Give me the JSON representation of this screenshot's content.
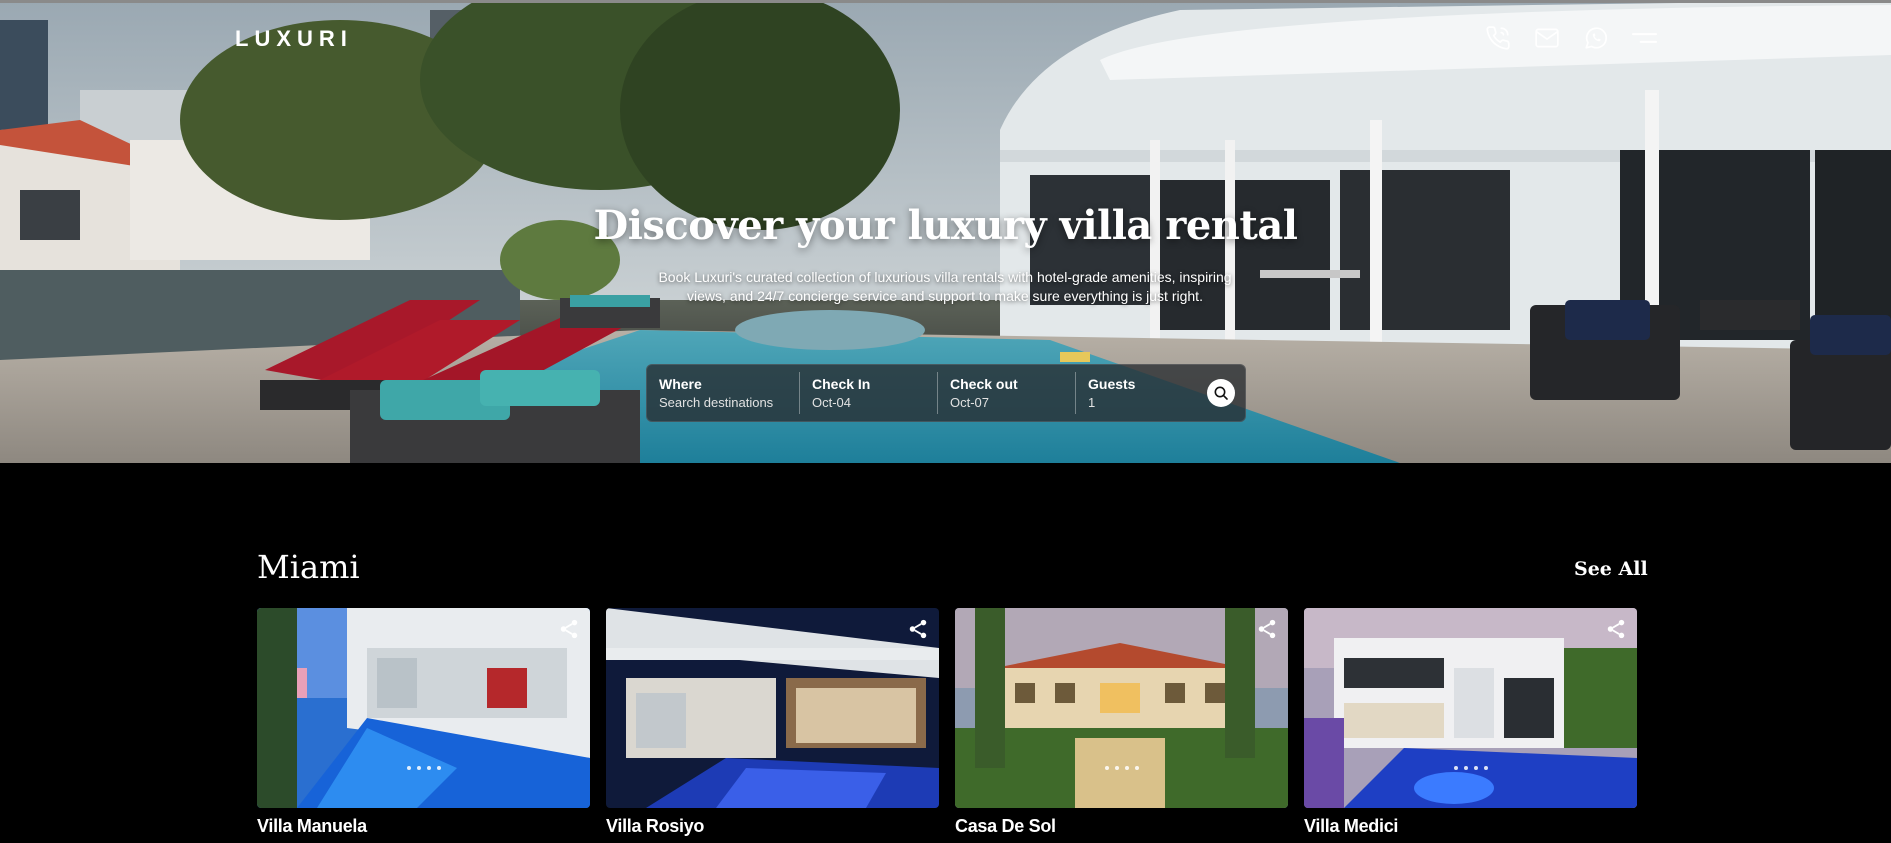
{
  "header": {
    "brand": "LUXURI",
    "icons": [
      "phone-icon",
      "mail-icon",
      "whatsapp-icon",
      "menu-icon"
    ]
  },
  "hero": {
    "title": "Discover your luxury villa rental",
    "subtitle": "Book Luxuri's curated collection of luxurious villa rentals with hotel-grade amenities, inspiring views, and 24/7 concierge service and support to make sure everything is just right."
  },
  "search": {
    "where": {
      "label": "Where",
      "value": "Search destinations"
    },
    "check_in": {
      "label": "Check In",
      "value": "Oct-04"
    },
    "check_out": {
      "label": "Check out",
      "value": "Oct-07"
    },
    "guests": {
      "label": "Guests",
      "value": "1"
    },
    "button_icon": "search-icon"
  },
  "section": {
    "title": "Miami",
    "see_all": "See All",
    "villas": [
      {
        "name": "Villa Manuela"
      },
      {
        "name": "Villa Rosiyo"
      },
      {
        "name": "Casa De Sol"
      },
      {
        "name": "Villa Medici"
      }
    ]
  },
  "colors": {
    "background": "#000000",
    "text": "#ffffff",
    "search_bar": "#2c3034",
    "pool_blue": "#1e6fd9",
    "lounger_red": "#b01a2a"
  }
}
